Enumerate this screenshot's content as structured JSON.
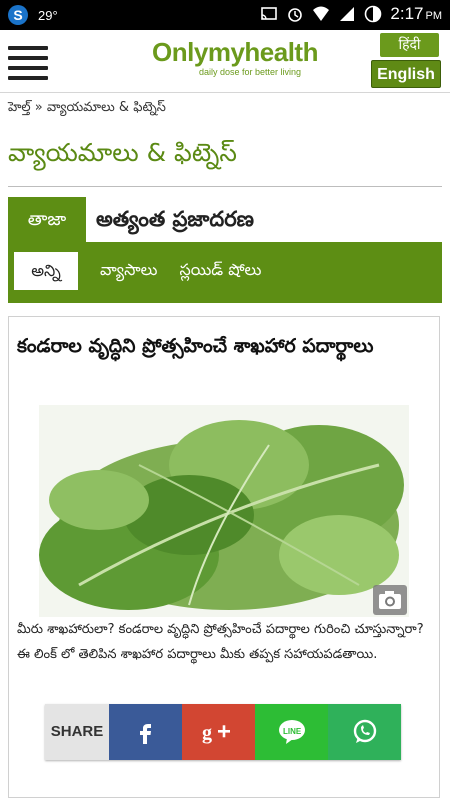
{
  "status_bar": {
    "temperature": "29°",
    "time": "2:17",
    "ampm": "PM"
  },
  "header": {
    "logo_text": "Onlymyhealth",
    "tagline": "daily dose for better living",
    "lang_hindi": "हिंदी",
    "lang_english": "English"
  },
  "breadcrumb": "హెల్త్ » వ్యాయమాలు & ఫిట్నెస్",
  "page_title": "వ్యాయమాలు & ఫిట్నెస్",
  "tabs": {
    "latest": "తాజా",
    "popular": "అత్యంత ప్రజాదరణ",
    "sub": [
      "అన్ని",
      "వ్యాసాలు",
      "స్లయిడ్ షోలు"
    ]
  },
  "article": {
    "title": "కండరాల వృద్ధిని ప్రోత్సహించే శాఖహార పదార్థాలు",
    "summary": "మీరు శాఖహారులా? కండరాల వృద్ధిని ప్రోత్సహించే పదార్థాల గురించి చూస్తున్నారా? ఈ లింక్ లో తెలిపిన శాఖహార పదార్థాలు మీకు తప్పక సహాయపడతాయి."
  },
  "share": {
    "label": "SHARE"
  },
  "colors": {
    "brand_green": "#5d8e14",
    "facebook": "#3a5a98",
    "google_plus": "#d24632",
    "line": "#2dbd35",
    "whatsapp": "#2fb15a"
  }
}
